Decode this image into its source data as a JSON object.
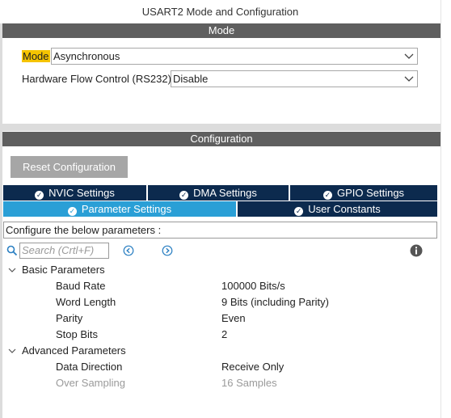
{
  "window": {
    "title": "USART2 Mode and Configuration"
  },
  "mode_section": {
    "header": "Mode",
    "mode_label": "Mode",
    "mode_value": "Asynchronous",
    "flow_label": "Hardware Flow Control (RS232)",
    "flow_value": "Disable"
  },
  "config_section": {
    "header": "Configuration",
    "reset_button": "Reset Configuration",
    "tabs_row1": [
      {
        "label": "NVIC Settings"
      },
      {
        "label": "DMA Settings"
      },
      {
        "label": "GPIO Settings"
      }
    ],
    "tabs_row2": [
      {
        "label": "Parameter Settings",
        "active": true
      },
      {
        "label": "User Constants",
        "active": false
      }
    ],
    "configure_text": "Configure the below parameters :",
    "search_placeholder": "Search (Crtl+F)"
  },
  "parameters": {
    "basic_group": "Basic Parameters",
    "basic": [
      {
        "name": "Baud Rate",
        "value": "100000 Bits/s"
      },
      {
        "name": "Word Length",
        "value": "9 Bits (including Parity)"
      },
      {
        "name": "Parity",
        "value": "Even"
      },
      {
        "name": "Stop Bits",
        "value": "2"
      }
    ],
    "advanced_group": "Advanced Parameters",
    "advanced": [
      {
        "name": "Data Direction",
        "value": "Receive Only",
        "disabled": false
      },
      {
        "name": "Over Sampling",
        "value": "16 Samples",
        "disabled": true
      }
    ]
  },
  "colors": {
    "section_bar": "#5f5f5f",
    "tab_dark": "#0c2a4e",
    "tab_active": "#2a9fd6",
    "mode_highlight": "#f5c400",
    "reset_button_bg": "#a6a6a6"
  },
  "icons": [
    "chevron-down-icon",
    "check-circle-icon",
    "search-icon",
    "arrow-left-circle-icon",
    "arrow-right-circle-icon",
    "info-icon",
    "expand-chevron-icon"
  ]
}
